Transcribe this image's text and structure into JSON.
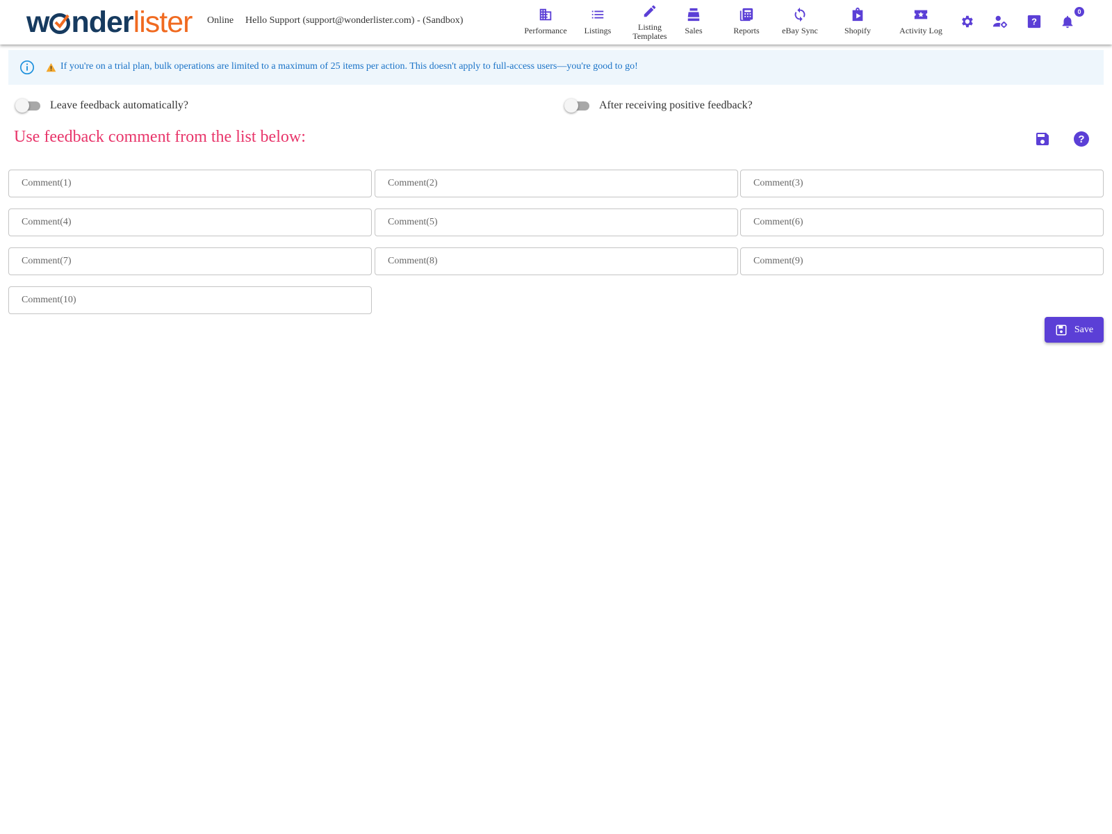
{
  "header": {
    "logo_part1": "w",
    "logo_part2": "nder",
    "logo_part3": "lister",
    "status": "Online",
    "greeting": "Hello Support (support@wonderlister.com) - (Sandbox)",
    "nav": [
      {
        "label": "Performance",
        "icon": "building-icon"
      },
      {
        "label": "Listings",
        "icon": "list-icon"
      },
      {
        "label_line1": "Listing",
        "label_line2": "Templates",
        "icon": "pencil-icon"
      },
      {
        "label": "Sales",
        "icon": "cash-register-icon"
      },
      {
        "label": "Reports",
        "icon": "calculator-icon"
      },
      {
        "label": "eBay Sync",
        "icon": "sync-icon"
      },
      {
        "label": "Shopify",
        "icon": "shopping-bag-icon"
      },
      {
        "label": "Activity Log",
        "icon": "ticket-star-icon"
      }
    ],
    "notification_count": "0",
    "accent_color": "#5b3fd6"
  },
  "banner": {
    "message": "If you're on a trial plan, bulk operations are limited to a maximum of 25 items per action. This doesn't apply to full-access users—you're good to go!"
  },
  "toggles": {
    "leave_feedback_label": "Leave feedback automatically?",
    "leave_feedback_on": false,
    "after_positive_label": "After receiving positive feedback?",
    "after_positive_on": false
  },
  "section": {
    "title": "Use feedback comment from the list below:"
  },
  "comments": [
    {
      "placeholder": "Comment(1)",
      "value": ""
    },
    {
      "placeholder": "Comment(2)",
      "value": ""
    },
    {
      "placeholder": "Comment(3)",
      "value": ""
    },
    {
      "placeholder": "Comment(4)",
      "value": ""
    },
    {
      "placeholder": "Comment(5)",
      "value": ""
    },
    {
      "placeholder": "Comment(6)",
      "value": ""
    },
    {
      "placeholder": "Comment(7)",
      "value": ""
    },
    {
      "placeholder": "Comment(8)",
      "value": ""
    },
    {
      "placeholder": "Comment(9)",
      "value": ""
    },
    {
      "placeholder": "Comment(10)",
      "value": ""
    }
  ],
  "actions": {
    "save_label": "Save"
  }
}
